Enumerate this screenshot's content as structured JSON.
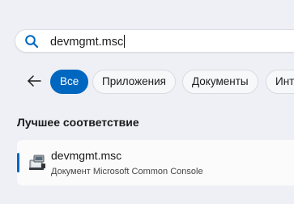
{
  "search": {
    "value": "devmgmt.msc"
  },
  "filters": [
    {
      "label": "Все",
      "active": true
    },
    {
      "label": "Приложения",
      "active": false
    },
    {
      "label": "Документы",
      "active": false
    },
    {
      "label": "Инт",
      "active": false
    }
  ],
  "section": {
    "title": "Лучшее соответствие"
  },
  "best_match": {
    "title": "devmgmt.msc",
    "subtitle": "Документ Microsoft Common Console",
    "icon": "msc-document-icon"
  },
  "colors": {
    "accent": "#0067c0",
    "background": "#eef0f5"
  }
}
